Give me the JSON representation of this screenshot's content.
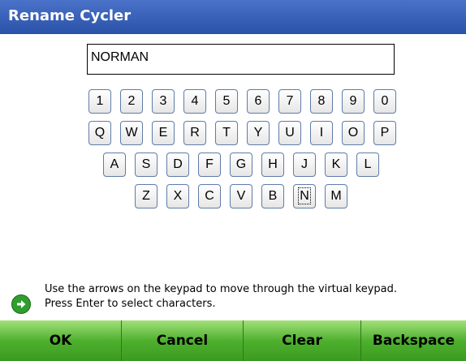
{
  "window": {
    "title": "Rename Cycler"
  },
  "input": {
    "value": "NORMAN"
  },
  "keypad": {
    "rows": [
      [
        "1",
        "2",
        "3",
        "4",
        "5",
        "6",
        "7",
        "8",
        "9",
        "0"
      ],
      [
        "Q",
        "W",
        "E",
        "R",
        "T",
        "Y",
        "U",
        "I",
        "O",
        "P"
      ],
      [
        "A",
        "S",
        "D",
        "F",
        "G",
        "H",
        "J",
        "K",
        "L"
      ],
      [
        "Z",
        "X",
        "C",
        "V",
        "B",
        "N",
        "M"
      ]
    ],
    "focused_key": "N"
  },
  "hint": {
    "icon": "arrow-right-circle-icon",
    "line1": "Use the arrows on the keypad to move through the virtual keypad.",
    "line2": "Press Enter to select characters."
  },
  "softkeys": {
    "ok": "OK",
    "cancel": "Cancel",
    "clear": "Clear",
    "backspace": "Backspace"
  },
  "colors": {
    "title_bar": "#3b63bb",
    "softkey_green": "#4fb02e",
    "key_border": "#5f7ca8"
  }
}
